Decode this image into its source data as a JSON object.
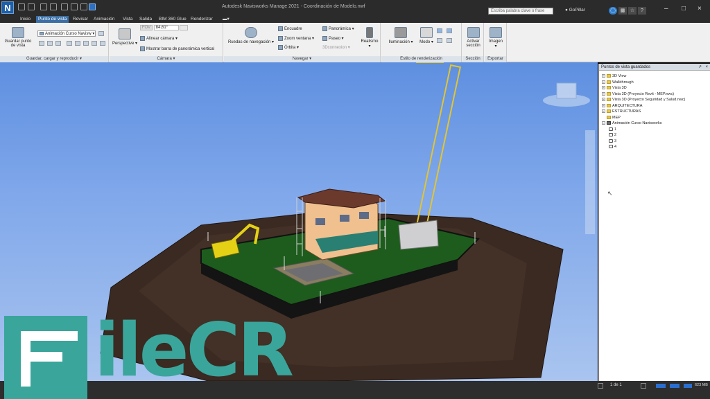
{
  "app": {
    "icon_letter": "N",
    "window_title": "Autodesk Navisworks Manage 2021 - Coordinación de Modelo.nwf"
  },
  "titlebar": {
    "search_placeholder": "Escriba palabra clave o frase",
    "user": "GoPillar"
  },
  "tabs": [
    {
      "label": "Inicio",
      "active": false
    },
    {
      "label": "Punto de vista",
      "active": true
    },
    {
      "label": "Revisar",
      "active": false
    },
    {
      "label": "Animación",
      "active": false
    },
    {
      "label": "Vista",
      "active": false
    },
    {
      "label": "Salida",
      "active": false
    },
    {
      "label": "BIM 360 Glue",
      "active": false
    },
    {
      "label": "Renderizar",
      "active": false
    }
  ],
  "ribbon": {
    "save_viewpoint": "Guardar punto de vista",
    "animation_select": "Animación Curso Navisw",
    "group_save": "Guardar, cargar y reproducir",
    "perspective": "Perspective",
    "fov_label": "FOV",
    "fov_value": "84,61°",
    "align_camera": "Alinear cámara",
    "show_horizon_bar": "Mostrar barra de panorámica vertical",
    "group_camera": "Cámara",
    "nav_wheels": "Ruedas de navegación",
    "pan": "Encuadre",
    "zoom_window": "Zoom ventana",
    "orbit": "Órbita",
    "panoramic": "Panorámica",
    "walk": "Paseo",
    "connexion": "3Dconnexion",
    "realism": "Realismo",
    "group_navigate": "Navegar",
    "lighting": "Iluminación",
    "mode": "Modo",
    "group_render_style": "Estilo de renderización",
    "enable_section": "Activar sección",
    "group_section": "Sección",
    "image": "Imagen",
    "group_export": "Exportar"
  },
  "viewpoints_panel": {
    "title": "Puntos de vista guardados",
    "items": [
      {
        "label": "3D View",
        "type": "folder",
        "level": 0
      },
      {
        "label": "Walkthrough",
        "type": "folder",
        "level": 0
      },
      {
        "label": "Vista 3D",
        "type": "folder",
        "level": 0
      },
      {
        "label": "Vista 3D (Proyecto Revit - MEP.nwc)",
        "type": "folder",
        "level": 0
      },
      {
        "label": "Vista 3D (Proyecto Seguridad y Salud.nwc)",
        "type": "folder",
        "level": 0
      },
      {
        "label": "ARQUITECTURA",
        "type": "folder",
        "level": 0
      },
      {
        "label": "ESTRUCTURAS",
        "type": "folder",
        "level": 0
      },
      {
        "label": "MEP",
        "type": "folder",
        "level": 0
      },
      {
        "label": "Animación Curso Navisworks",
        "type": "anim",
        "level": 0
      },
      {
        "label": "1",
        "type": "view",
        "level": 1
      },
      {
        "label": "2",
        "type": "view",
        "level": 1
      },
      {
        "label": "3",
        "type": "view",
        "level": 1
      },
      {
        "label": "4",
        "type": "view",
        "level": 1
      }
    ]
  },
  "statusbar": {
    "page": "1 de 1",
    "memory": "623 MB"
  },
  "watermark": {
    "text": "ileCR",
    "tagline": "FILE CR"
  }
}
